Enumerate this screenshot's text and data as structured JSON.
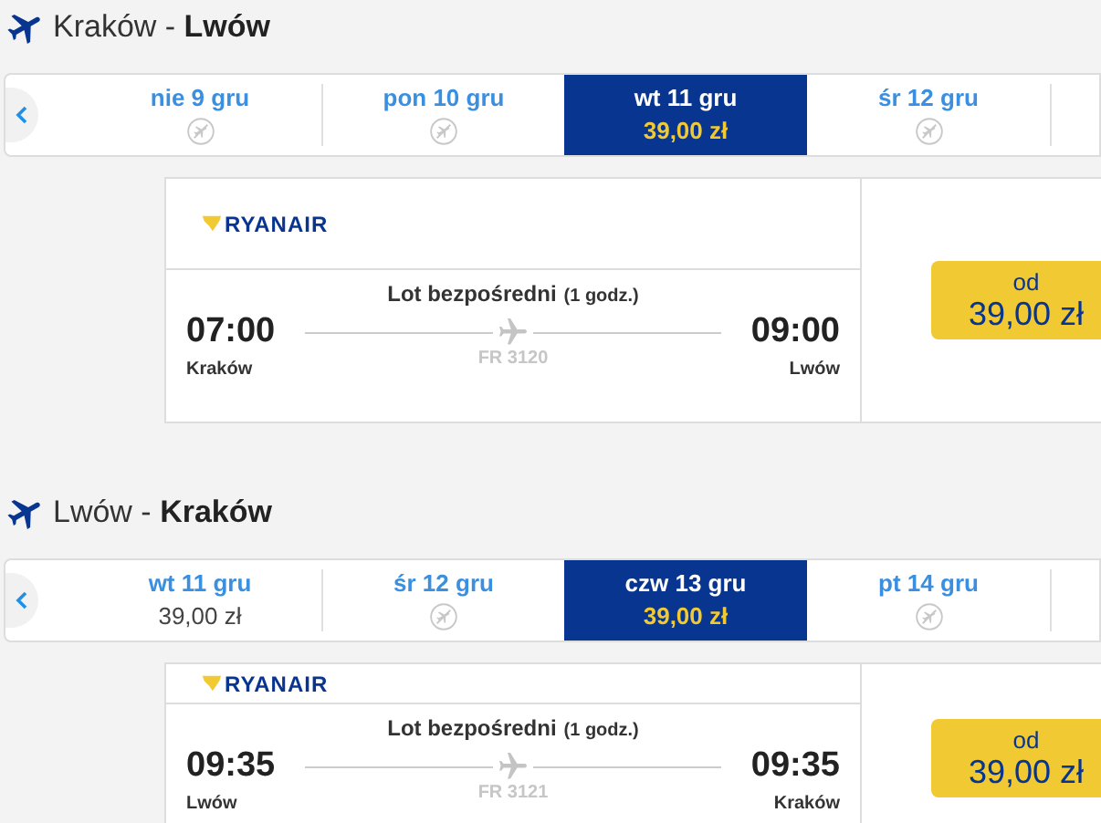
{
  "sections": [
    {
      "title": "Kraków - **Lwów**",
      "dates": [
        {
          "label": "nie 9 gru",
          "selected": false,
          "kind": "no-flight"
        },
        {
          "label": "pon 10 gru",
          "selected": false,
          "kind": "no-flight"
        },
        {
          "label": "wt 11 gru",
          "selected": true,
          "kind": "price",
          "price": "39,00 zł"
        },
        {
          "label": "śr 12 gru",
          "selected": false,
          "kind": "no-flight"
        }
      ],
      "flight": {
        "airline": "RYANAIR",
        "type": "Lot bezpośredni",
        "duration": "(1 godz.)",
        "depart": "07:00",
        "arrive": "09:00",
        "from": "Kraków",
        "to": "Lwów",
        "number": "FR 3120",
        "price_label": "od",
        "price": "39,00 zł"
      }
    },
    {
      "title": "Lwów - **Kraków**",
      "dates": [
        {
          "label": "wt 11 gru",
          "selected": false,
          "kind": "price",
          "price": "39,00 zł"
        },
        {
          "label": "śr 12 gru",
          "selected": false,
          "kind": "no-flight"
        },
        {
          "label": "czw 13 gru",
          "selected": true,
          "kind": "price",
          "price": "39,00 zł"
        },
        {
          "label": "pt 14 gru",
          "selected": false,
          "kind": "no-flight"
        }
      ],
      "flight": {
        "airline": "RYANAIR",
        "type": "Lot bezpośredni",
        "duration": "(1 godz.)",
        "depart": "09:35",
        "arrive": "09:35",
        "from": "Lwów",
        "to": "Kraków",
        "number": "FR 3121",
        "price_label": "od",
        "price": "39,00 zł"
      }
    }
  ]
}
